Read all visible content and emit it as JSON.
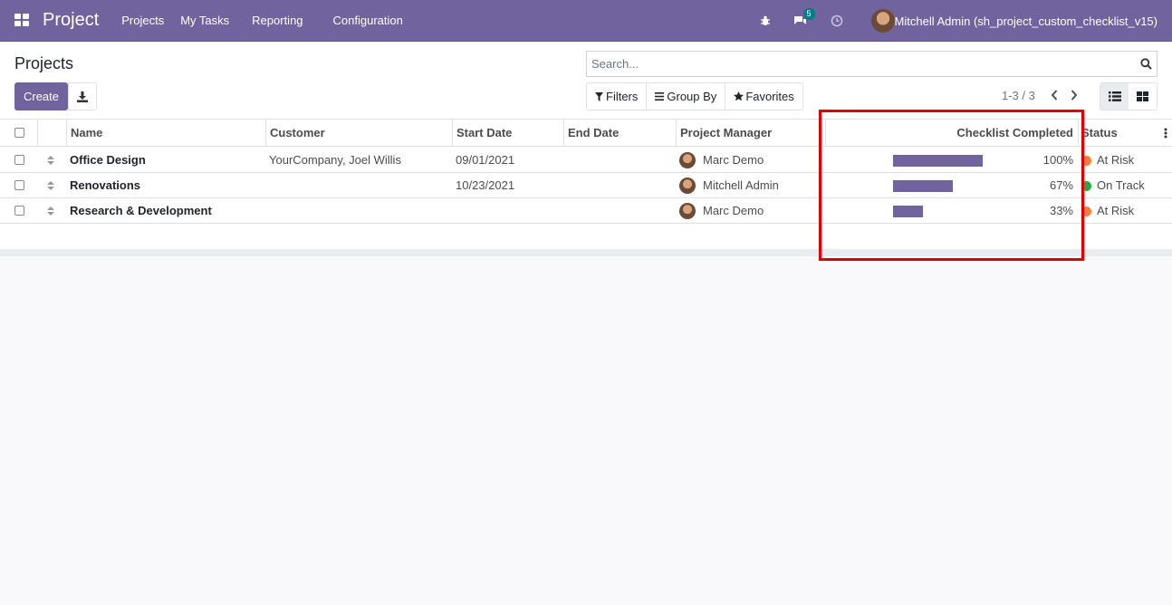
{
  "navbar": {
    "brand": "Project",
    "menu": [
      "Projects",
      "My Tasks",
      "Reporting",
      "Configuration"
    ],
    "messages_count": "5",
    "user_name": "Mitchell Admin (sh_project_custom_checklist_v15)"
  },
  "control_panel": {
    "breadcrumb": "Projects",
    "create_label": "Create",
    "search_placeholder": "Search...",
    "filters_label": "Filters",
    "groupby_label": "Group By",
    "favorites_label": "Favorites",
    "pager": "1-3 / 3"
  },
  "table": {
    "columns": [
      "Name",
      "Customer",
      "Start Date",
      "End Date",
      "Project Manager",
      "Checklist Completed",
      "Status"
    ],
    "rows": [
      {
        "name": "Office Design",
        "customer": "YourCompany, Joel Willis",
        "start_date": "09/01/2021",
        "end_date": "",
        "manager": "Marc Demo",
        "checklist_pct": "100%",
        "checklist_value": 1.0,
        "status": "At Risk",
        "status_color": "#f0803c"
      },
      {
        "name": "Renovations",
        "customer": "",
        "start_date": "10/23/2021",
        "end_date": "",
        "manager": "Mitchell Admin",
        "checklist_pct": "67%",
        "checklist_value": 0.67,
        "status": "On Track",
        "status_color": "#28a745"
      },
      {
        "name": "Research & Development",
        "customer": "",
        "start_date": "",
        "end_date": "",
        "manager": "Marc Demo",
        "checklist_pct": "33%",
        "checklist_value": 0.33,
        "status": "At Risk",
        "status_color": "#f0803c"
      }
    ]
  },
  "colors": {
    "brand": "#71639e",
    "highlight": "#e00000"
  }
}
